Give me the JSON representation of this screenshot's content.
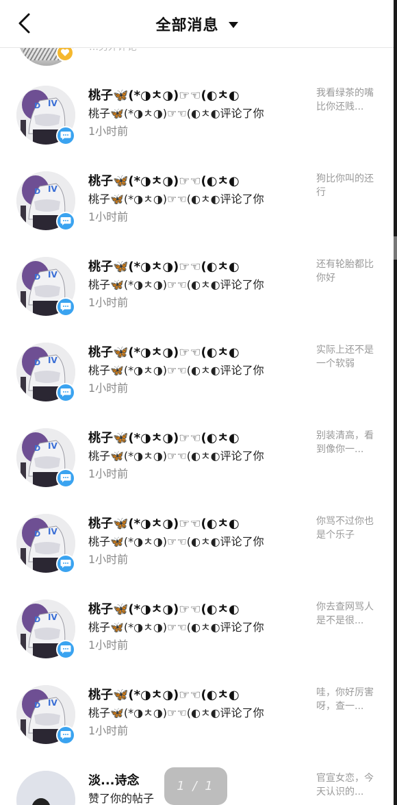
{
  "header": {
    "title": "全部消息"
  },
  "partial_row": {
    "text": "…另外评论"
  },
  "rows": [
    {
      "name": "桃子🦋(*◑ㅊ◑)☞☜(◐ㅊ◐",
      "action": "桃子🦋(*◑ㅊ◑)☞☜(◐ㅊ◐评论了你",
      "time": "1小时前",
      "snippet": "我看绿茶的嘴比你还贱..."
    },
    {
      "name": "桃子🦋(*◑ㅊ◑)☞☜(◐ㅊ◐",
      "action": "桃子🦋(*◑ㅊ◑)☞☜(◐ㅊ◐评论了你",
      "time": "1小时前",
      "snippet": "狗比你叫的还行"
    },
    {
      "name": "桃子🦋(*◑ㅊ◑)☞☜(◐ㅊ◐",
      "action": "桃子🦋(*◑ㅊ◑)☞☜(◐ㅊ◐评论了你",
      "time": "1小时前",
      "snippet": "还有轮胎都比你好"
    },
    {
      "name": "桃子🦋(*◑ㅊ◑)☞☜(◐ㅊ◐",
      "action": "桃子🦋(*◑ㅊ◑)☞☜(◐ㅊ◐评论了你",
      "time": "1小时前",
      "snippet": "实际上还不是一个软弱"
    },
    {
      "name": "桃子🦋(*◑ㅊ◑)☞☜(◐ㅊ◐",
      "action": "桃子🦋(*◑ㅊ◑)☞☜(◐ㅊ◐评论了你",
      "time": "1小时前",
      "snippet": "别装清高，看到像你一..."
    },
    {
      "name": "桃子🦋(*◑ㅊ◑)☞☜(◐ㅊ◐",
      "action": "桃子🦋(*◑ㅊ◑)☞☜(◐ㅊ◐评论了你",
      "time": "1小时前",
      "snippet": "你骂不过你也是个乐子"
    },
    {
      "name": "桃子🦋(*◑ㅊ◑)☞☜(◐ㅊ◐",
      "action": "桃子🦋(*◑ㅊ◑)☞☜(◐ㅊ◐评论了你",
      "time": "1小时前",
      "snippet": "你去查网骂人是不是很..."
    },
    {
      "name": "桃子🦋(*◑ㅊ◑)☞☜(◐ㅊ◐",
      "action": "桃子🦋(*◑ㅊ◑)☞☜(◐ㅊ◐评论了你",
      "time": "1小时前",
      "snippet": "哇，你好厉害呀，查一..."
    },
    {
      "name": "淡...诗念",
      "action": "赞了你的帖子",
      "time": "",
      "snippet": "官宣女恋，今天认识的..."
    }
  ],
  "pager": {
    "text": "1 / 1"
  },
  "colors": {
    "accent": "#3aa3f0",
    "gold": "#f5b82e"
  }
}
